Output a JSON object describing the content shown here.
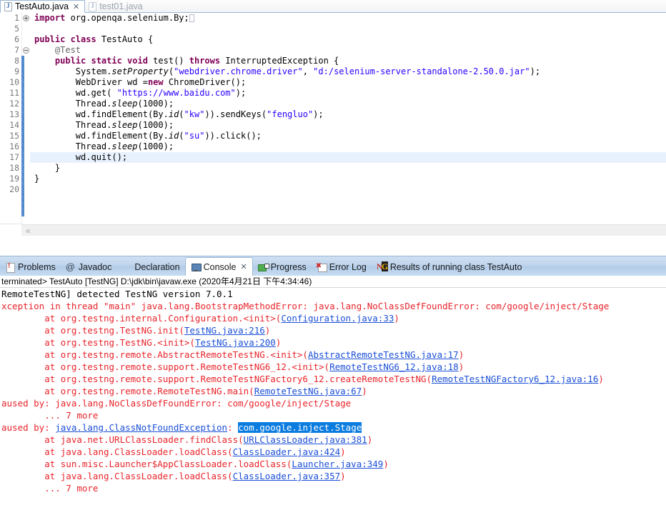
{
  "editor": {
    "tabs": [
      {
        "label": "TestAuto.java",
        "icon": "java-file-icon",
        "active": true,
        "close": "✕"
      },
      {
        "label": "test01.java",
        "icon": "java-file-icon",
        "active": false,
        "close": ""
      }
    ],
    "scroll_hint": "«",
    "lines": [
      {
        "num": "1",
        "marker": "plus",
        "html": "<span class=\"kw\">import</span> org.openqa.selenium.By;<span class=\"caret-box\"></span>"
      },
      {
        "num": "5",
        "marker": "",
        "html": ""
      },
      {
        "num": "6",
        "marker": "",
        "html": "<span class=\"kw\">public class</span> TestAuto {"
      },
      {
        "num": "7",
        "marker": "fold",
        "html": "    <span class=\"ann\">@Test</span>"
      },
      {
        "num": "8",
        "marker": "",
        "html": "    <span class=\"kw\">public static void</span> test() <span class=\"kw\">throws</span> InterruptedException {"
      },
      {
        "num": "9",
        "marker": "",
        "html": "        System.<span class=\"mth\">setProperty</span>(<span class=\"str\">\"webdriver.chrome.driver\"</span>, <span class=\"str\">\"d:/selenium-server-standalone-2.50.0.jar\"</span>);"
      },
      {
        "num": "10",
        "marker": "",
        "html": "        WebDriver wd =<span class=\"kw\">new</span> ChromeDriver();"
      },
      {
        "num": "11",
        "marker": "",
        "html": "        wd.get( <span class=\"str\">\"https://www.baidu.com\"</span>);"
      },
      {
        "num": "12",
        "marker": "",
        "html": "        Thread.<span class=\"mth\">sleep</span>(1000);"
      },
      {
        "num": "13",
        "marker": "",
        "html": "        wd.findElement(By.<span class=\"mth\">id</span>(<span class=\"str\">\"kw\"</span>)).sendKeys(<span class=\"str\">\"fengluo\"</span>);"
      },
      {
        "num": "14",
        "marker": "",
        "html": "        Thread.<span class=\"mth\">sleep</span>(1000);"
      },
      {
        "num": "15",
        "marker": "",
        "html": "        wd.findElement(By.<span class=\"mth\">id</span>(<span class=\"str\">\"su\"</span>)).click();"
      },
      {
        "num": "16",
        "marker": "",
        "html": "        Thread.<span class=\"mth\">sleep</span>(1000);"
      },
      {
        "num": "17",
        "marker": "",
        "html": "        wd.quit();",
        "highlight": true
      },
      {
        "num": "18",
        "marker": "",
        "html": "    }"
      },
      {
        "num": "19",
        "marker": "",
        "html": "}"
      },
      {
        "num": "20",
        "marker": "",
        "html": ""
      }
    ]
  },
  "view_tabs": [
    {
      "label": "Problems",
      "icon": "problems-icon",
      "active": false,
      "close": ""
    },
    {
      "label": "Javadoc",
      "icon": "javadoc-icon",
      "active": false,
      "close": ""
    },
    {
      "label": "Declaration",
      "icon": "declaration-icon",
      "active": false,
      "close": ""
    },
    {
      "label": "Console",
      "icon": "console-icon",
      "active": true,
      "close": "✕"
    },
    {
      "label": "Progress",
      "icon": "progress-icon",
      "active": false,
      "close": ""
    },
    {
      "label": "Error Log",
      "icon": "error-log-icon",
      "active": false,
      "close": ""
    },
    {
      "label": "Results of running class TestAuto",
      "icon": "testng-icon",
      "active": false,
      "close": ""
    }
  ],
  "console": {
    "header": "terminated> TestAuto [TestNG] D:\\jdk\\bin\\javaw.exe (2020年4月21日 下午4:34:46)",
    "lines": [
      {
        "err": false,
        "html": "RemoteTestNG] detected TestNG version 7.0.1"
      },
      {
        "err": true,
        "html": "xception in thread \"main\" java.lang.BootstrapMethodError: java.lang.NoClassDefFoundError: com/google/inject/Stage"
      },
      {
        "err": true,
        "html": "        at org.testng.internal.Configuration.&lt;init&gt;(<span class=\"lnk\">Configuration.java:33</span>)"
      },
      {
        "err": true,
        "html": "        at org.testng.TestNG.init(<span class=\"lnk\">TestNG.java:216</span>)"
      },
      {
        "err": true,
        "html": "        at org.testng.TestNG.&lt;init&gt;(<span class=\"lnk\">TestNG.java:200</span>)"
      },
      {
        "err": true,
        "html": "        at org.testng.remote.AbstractRemoteTestNG.&lt;init&gt;(<span class=\"lnk\">AbstractRemoteTestNG.java:17</span>)"
      },
      {
        "err": true,
        "html": "        at org.testng.remote.support.RemoteTestNG6_12.&lt;init&gt;(<span class=\"lnk\">RemoteTestNG6_12.java:18</span>)"
      },
      {
        "err": true,
        "html": "        at org.testng.remote.support.RemoteTestNGFactory6_12.createRemoteTestNG(<span class=\"lnk\">RemoteTestNGFactory6_12.java:16</span>)"
      },
      {
        "err": true,
        "html": "        at org.testng.remote.RemoteTestNG.main(<span class=\"lnk\">RemoteTestNG.java:67</span>)"
      },
      {
        "err": true,
        "html": "aused by: java.lang.NoClassDefFoundError: com/google/inject/Stage"
      },
      {
        "err": true,
        "html": "        ... 7 more"
      },
      {
        "err": true,
        "html": "aused by: <span class=\"lnk\">java.lang.ClassNotFoundException</span>: <span class=\"sel\">com.google.inject.Stage</span>"
      },
      {
        "err": true,
        "html": "        at java.net.URLClassLoader.findClass(<span class=\"lnk\">URLClassLoader.java:381</span>)"
      },
      {
        "err": true,
        "html": "        at java.lang.ClassLoader.loadClass(<span class=\"lnk\">ClassLoader.java:424</span>)"
      },
      {
        "err": true,
        "html": "        at sun.misc.Launcher$AppClassLoader.loadClass(<span class=\"lnk\">Launcher.java:349</span>)"
      },
      {
        "err": true,
        "html": "        at java.lang.ClassLoader.loadClass(<span class=\"lnk\">ClassLoader.java:357</span>)"
      },
      {
        "err": true,
        "html": "        ... 7 more"
      }
    ],
    "selection_text": "com.google.inject.Stage"
  },
  "colors": {
    "keyword": "#7f0055",
    "string": "#2a00ff",
    "error_text": "#e8242b",
    "link": "#1a4fd6",
    "selection_bg": "#0a7ce0",
    "tab_bar": "#bed4ec",
    "line_highlight": "#e8f2fe"
  }
}
